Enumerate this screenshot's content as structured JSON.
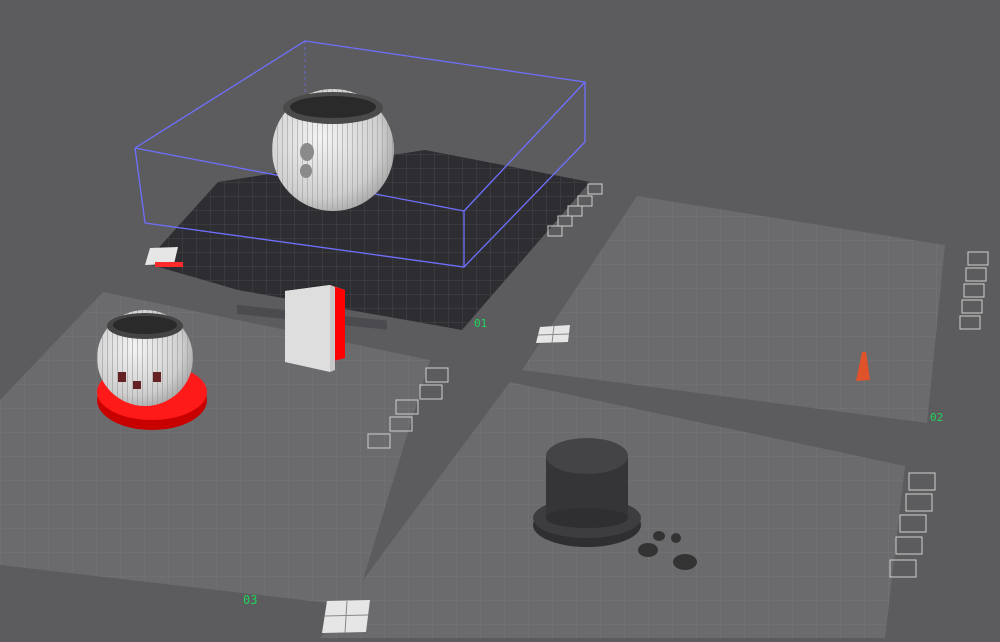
{
  "viewport": {
    "background": "#5c5c5f",
    "bed_color": "#6b6b6e",
    "active_bed_color": "#2e2e32",
    "bbox_color": "#6f6fff",
    "label_color": "#1fd35a",
    "selected_color": "#ff0000"
  },
  "plates": [
    {
      "label": "01",
      "active": true
    },
    {
      "label": "02",
      "active": false
    },
    {
      "label": "03",
      "active": false
    },
    {
      "label": "",
      "active": false
    }
  ],
  "plate_toolbar": {
    "icons": [
      "close-icon",
      "auto-arrange-icon",
      "plate-settings-icon",
      "lock-icon",
      "auto-orient-icon"
    ]
  },
  "objects": [
    {
      "name": "hollow-sphere",
      "plate": "01",
      "color": "#dcdcdc"
    },
    {
      "name": "hollow-sphere",
      "plate": "03",
      "color": "#dcdcdc"
    },
    {
      "name": "red-ring-base",
      "plate": "03",
      "color": "#ff0000"
    },
    {
      "name": "block",
      "plate": "",
      "color": "#e0e0e0"
    },
    {
      "name": "cone",
      "plate": "02",
      "color": "#e0522a"
    },
    {
      "name": "top-hat",
      "plate": "",
      "color": "#3a3a3a"
    },
    {
      "name": "small-stones",
      "plate": "",
      "color": "#3a3a3a"
    }
  ]
}
